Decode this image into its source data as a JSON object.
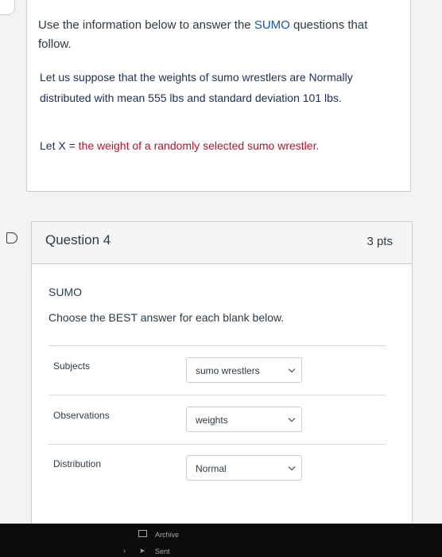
{
  "intro": {
    "line_prefix": "Use the information below to answer the ",
    "highlight": "SUMO",
    "line_suffix": " questions that follow."
  },
  "paragraph1": "Let us suppose that the weights of sumo wrestlers are Normally distributed with mean 555 lbs and standard deviation 101 lbs.",
  "paragraph2": {
    "prefix": "Let X = ",
    "red": "the weight of a randomly selected sumo wrestler."
  },
  "question": {
    "title": "Question 4",
    "points": "3 pts",
    "topic": "SUMO",
    "instructions": "Choose the BEST answer for each blank below.",
    "rows": [
      {
        "label": "Subjects",
        "selected": "sumo wrestlers"
      },
      {
        "label": "Observations",
        "selected": "weights"
      },
      {
        "label": "Distribution",
        "selected": "Normal"
      }
    ]
  },
  "bottom_nav": {
    "archive": "Archive",
    "sent": "Sent"
  },
  "colors": {
    "highlight_blue": "#1b56a8",
    "red_text": "#b3162a",
    "card_border": "#c7cdd1"
  }
}
